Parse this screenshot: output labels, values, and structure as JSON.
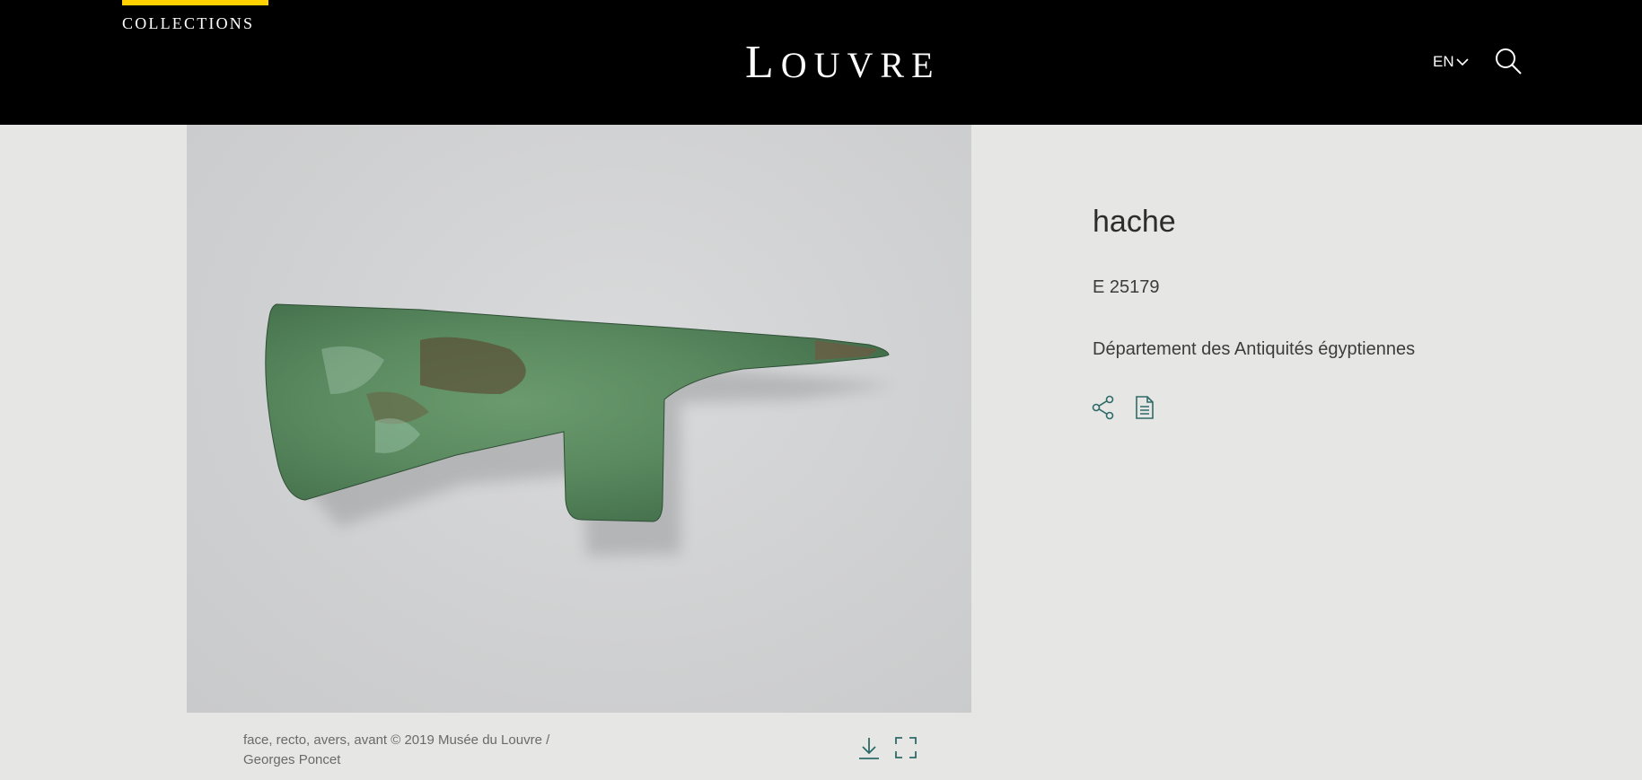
{
  "header": {
    "collections_label": "Collections",
    "logo_text_initial": "L",
    "logo_text_rest": "OUVRE",
    "language": "EN",
    "accent_color": "#ffd200"
  },
  "artwork": {
    "image_alt": "hache",
    "credit": "face, recto, avers, avant © 2019 Musée du Louvre / Georges Poncet"
  },
  "info": {
    "title": "hache",
    "inventory_number": "E 25179",
    "department": "Département des Antiquités égyptiennes"
  },
  "icons": {
    "lang": "chevron-down-icon",
    "search": "search-icon",
    "download": "download-icon",
    "fullscreen": "fullscreen-icon",
    "share": "share-icon",
    "notice": "document-icon",
    "icon_color": "#2e6b68"
  }
}
